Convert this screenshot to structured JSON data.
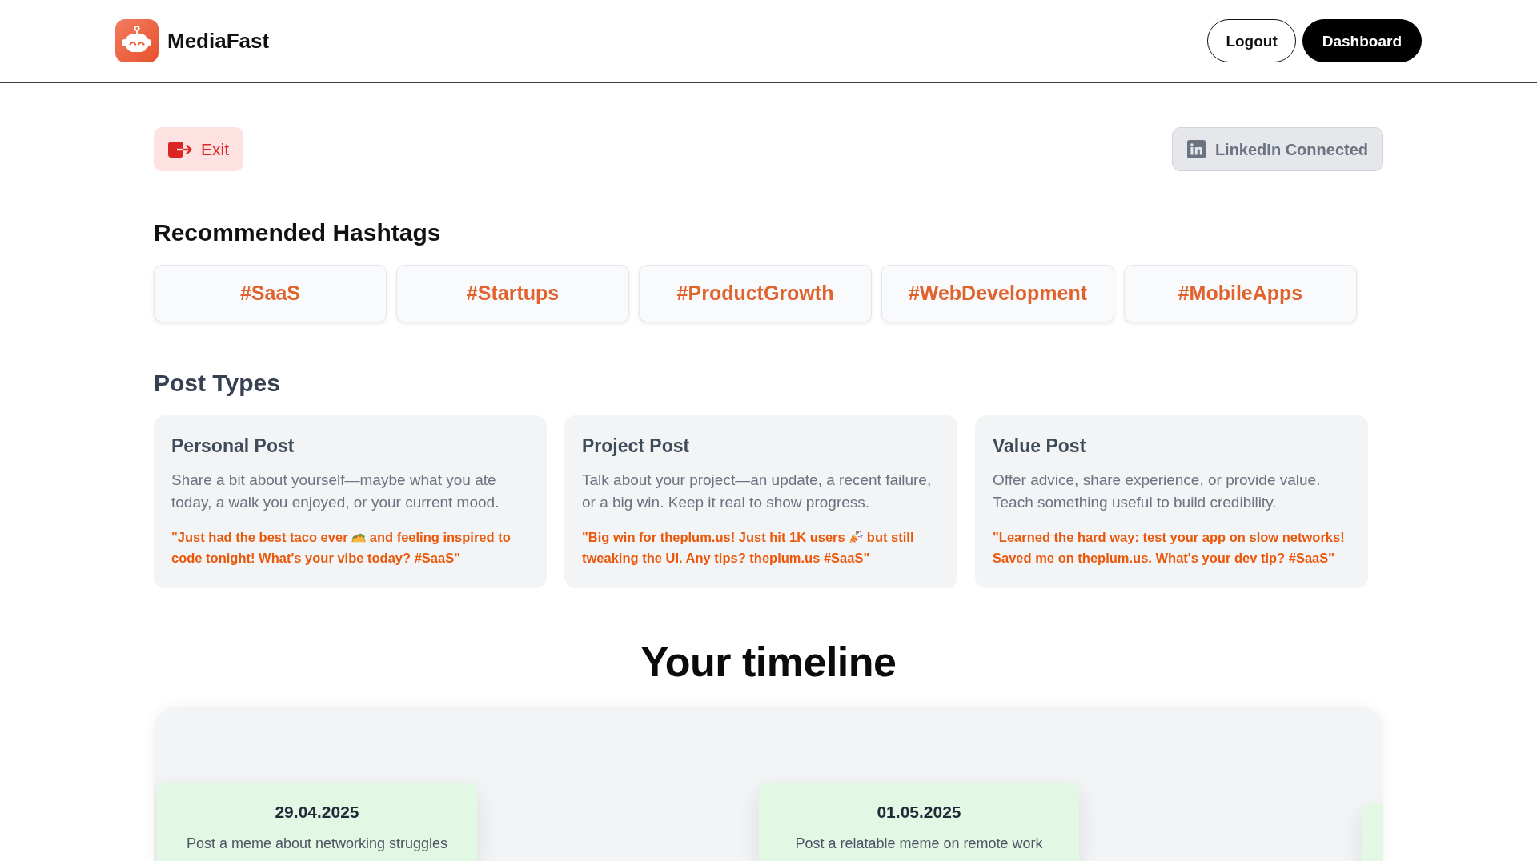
{
  "header": {
    "brand": "MediaFast",
    "buttons": [
      {
        "label": "Logout",
        "kind": "outline"
      },
      {
        "label": "Dashboard",
        "kind": "solid"
      }
    ]
  },
  "exit_button": {
    "label": "Exit"
  },
  "linkedin_status": {
    "label": "LinkedIn Connected",
    "disabled": true
  },
  "hashtags": {
    "title": "Recommended Hashtags",
    "items": [
      "#SaaS",
      "#Startups",
      "#ProductGrowth",
      "#WebDevelopment",
      "#MobileApps"
    ]
  },
  "post_types": {
    "title": "Post Types",
    "cards": [
      {
        "title": "Personal Post",
        "description": "Share a bit about yourself—maybe what you ate today, a walk you enjoyed, or your current mood.",
        "example": [
          {
            "kind": "text",
            "text": "\"Just had the best taco ever "
          },
          {
            "kind": "taco"
          },
          {
            "kind": "text",
            "text": " and feeling inspired to code tonight! What's your vibe today? #SaaS\""
          }
        ]
      },
      {
        "title": "Project Post",
        "description": "Talk about your project—an update, a recent failure, or a big win. Keep it real to show progress.",
        "example": [
          {
            "kind": "text",
            "text": "\"Big win for theplum.us! Just hit 1K users "
          },
          {
            "kind": "party"
          },
          {
            "kind": "text",
            "text": " but still tweaking the UI. Any tips? theplum.us #SaaS\""
          }
        ]
      },
      {
        "title": "Value Post",
        "description": "Offer advice, share experience, or provide value. Teach something useful to build credibility.",
        "example": [
          {
            "kind": "text",
            "text": "\"Learned the hard way: test your app on slow networks! Saved me on theplum.us. What's your dev tip? #SaaS\""
          }
        ]
      }
    ]
  },
  "timeline": {
    "title": "Your timeline",
    "cards": [
      {
        "date": "29.04.2025",
        "task": "Post a meme about networking struggles"
      },
      {
        "date": "01.05.2025",
        "task": "Post a relatable meme on remote work"
      }
    ],
    "next_card_peek": true
  }
}
